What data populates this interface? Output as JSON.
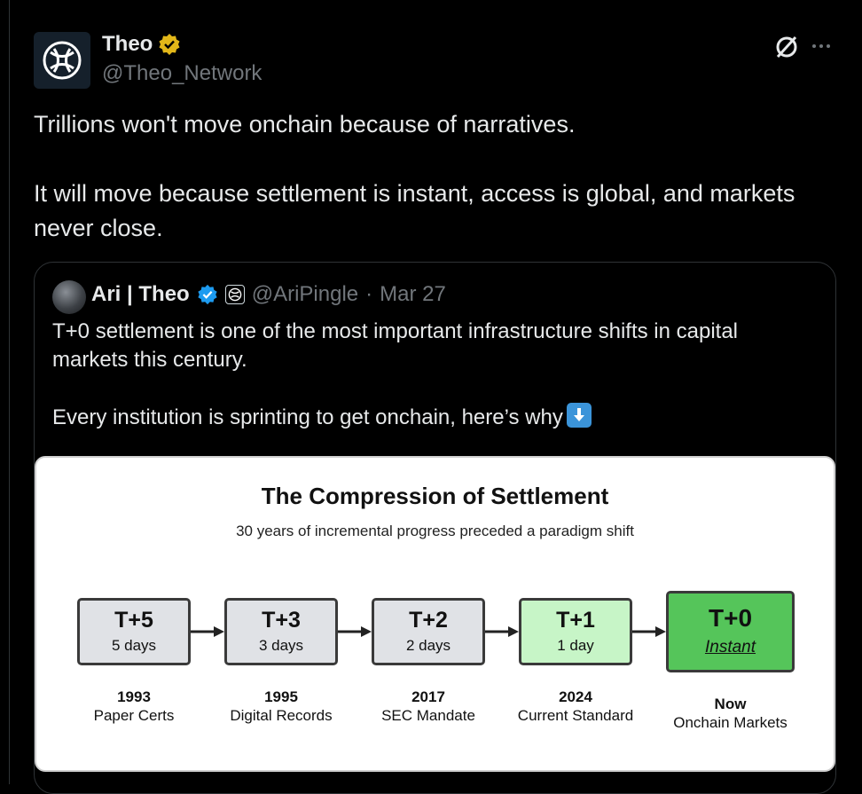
{
  "post": {
    "author_name": "Theo",
    "author_handle": "@Theo_Network",
    "text": "Trillions won't move onchain because of narratives.\n\nIt will move because settlement is instant, access is global, and markets never close."
  },
  "quote": {
    "author_name": "Ari | Theo",
    "author_handle": "@AriPingle",
    "separator": "·",
    "date": "Mar 27",
    "text": "T+0 settlement is one of the most important infrastructure shifts in capital markets this century.\n\nEvery institution is sprinting to get onchain, here’s why"
  },
  "infographic": {
    "title": "The Compression of Settlement",
    "subtitle": "30 years of incremental progress preceded a paradigm shift",
    "stages": [
      {
        "code": "T+5",
        "duration": "5 days",
        "year": "1993",
        "label": "Paper Certs",
        "fill": "#e0e2e6"
      },
      {
        "code": "T+3",
        "duration": "3 days",
        "year": "1995",
        "label": "Digital Records",
        "fill": "#e0e2e6"
      },
      {
        "code": "T+2",
        "duration": "2 days",
        "year": "2017",
        "label": "SEC Mandate",
        "fill": "#e0e2e6"
      },
      {
        "code": "T+1",
        "duration": "1 day",
        "year": "2024",
        "label": "Current Standard",
        "fill": "#c7f5c7"
      },
      {
        "code": "T+0",
        "duration": "Instant",
        "year": "Now",
        "label": "Onchain Markets",
        "fill": "#55c55a"
      }
    ]
  },
  "colors": {
    "background": "#000000",
    "text": "#e7e9ea",
    "muted": "#71767b",
    "verified_gold": "#e2b719",
    "verified_blue": "#1d9bf0"
  },
  "icons": [
    "theo-logo-icon",
    "verified-gold-icon",
    "grok-icon",
    "more-icon",
    "verified-blue-icon",
    "affiliate-icon",
    "down-arrow-emoji"
  ]
}
